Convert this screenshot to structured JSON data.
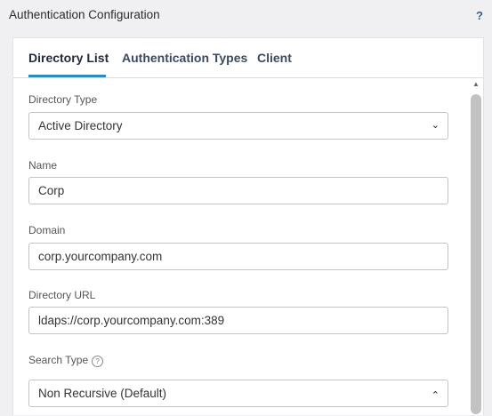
{
  "header": {
    "title": "Authentication Configuration",
    "help_label": "?"
  },
  "tabs": [
    {
      "label": "Directory List",
      "active": true
    },
    {
      "label": "Authentication Types",
      "active": false
    },
    {
      "label": "Client",
      "active": false
    }
  ],
  "form": {
    "directory_type": {
      "label": "Directory Type",
      "value": "Active Directory"
    },
    "name": {
      "label": "Name",
      "value": "Corp"
    },
    "domain": {
      "label": "Domain",
      "value": "corp.yourcompany.com"
    },
    "directory_url": {
      "label": "Directory URL",
      "value": "ldaps://corp.yourcompany.com:389"
    },
    "search_type": {
      "label": "Search Type",
      "info_glyph": "?",
      "value": "Non Recursive (Default)"
    }
  },
  "icons": {
    "chevron_down": "⌄",
    "chevron_up": "⌃",
    "scroll_up": "▲"
  },
  "colors": {
    "accent": "#2e8bb7",
    "help": "#3d5c80"
  }
}
